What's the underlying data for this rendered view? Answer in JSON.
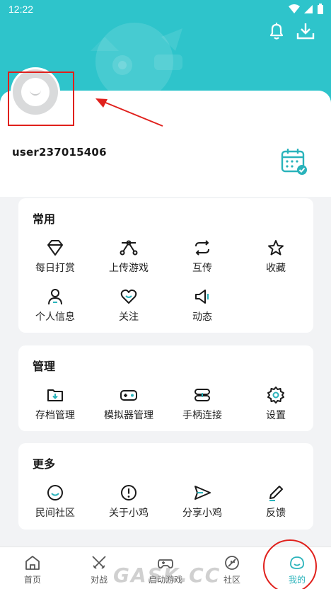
{
  "status_bar": {
    "time": "12:22"
  },
  "profile": {
    "username": "user237015406"
  },
  "sections": [
    {
      "title": "常用",
      "items": [
        {
          "label": "每日打赏",
          "icon": "diamond-icon"
        },
        {
          "label": "上传游戏",
          "icon": "upload-game-icon"
        },
        {
          "label": "互传",
          "icon": "transfer-icon"
        },
        {
          "label": "收藏",
          "icon": "star-icon"
        },
        {
          "label": "个人信息",
          "icon": "person-icon"
        },
        {
          "label": "关注",
          "icon": "heart-icon"
        },
        {
          "label": "动态",
          "icon": "megaphone-icon"
        }
      ]
    },
    {
      "title": "管理",
      "items": [
        {
          "label": "存档管理",
          "icon": "folder-download-icon"
        },
        {
          "label": "模拟器管理",
          "icon": "gamepad-icon"
        },
        {
          "label": "手柄连接",
          "icon": "link-icon"
        },
        {
          "label": "设置",
          "icon": "gear-icon"
        }
      ]
    },
    {
      "title": "更多",
      "items": [
        {
          "label": "民间社区",
          "icon": "smile-icon"
        },
        {
          "label": "关于小鸡",
          "icon": "info-icon"
        },
        {
          "label": "分享小鸡",
          "icon": "paper-plane-icon"
        },
        {
          "label": "反馈",
          "icon": "pencil-icon"
        }
      ]
    }
  ],
  "bottom_nav": [
    {
      "label": "首页",
      "icon": "home-icon"
    },
    {
      "label": "对战",
      "icon": "swords-icon"
    },
    {
      "label": "启动游戏",
      "icon": "controller-icon"
    },
    {
      "label": "社区",
      "icon": "leaf-icon"
    },
    {
      "label": "我的",
      "icon": "face-icon",
      "active": true
    }
  ],
  "watermark": "GASK.CC",
  "colors": {
    "accent": "#2ec4cb",
    "annotation": "#e0201c"
  }
}
